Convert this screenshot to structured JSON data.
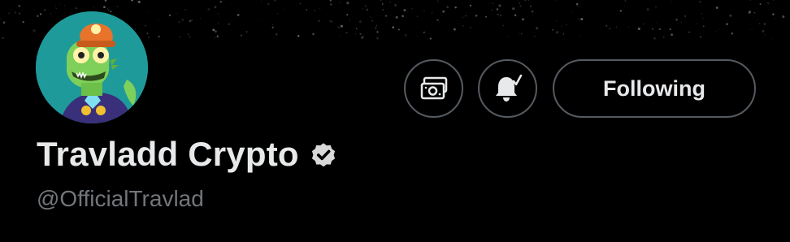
{
  "profile": {
    "display_name": "Travladd Crypto",
    "handle": "@OfficialTravlad",
    "verified": true
  },
  "actions": {
    "tip_icon": "money-icon",
    "notify_icon": "bell-check-icon",
    "following_label": "Following"
  },
  "colors": {
    "background": "#000000",
    "text_primary": "#e7e9ea",
    "text_secondary": "#71767b",
    "button_border": "#555b61",
    "avatar_bg": "#1f9a9a",
    "verified_badge": "#d9d9d9"
  }
}
